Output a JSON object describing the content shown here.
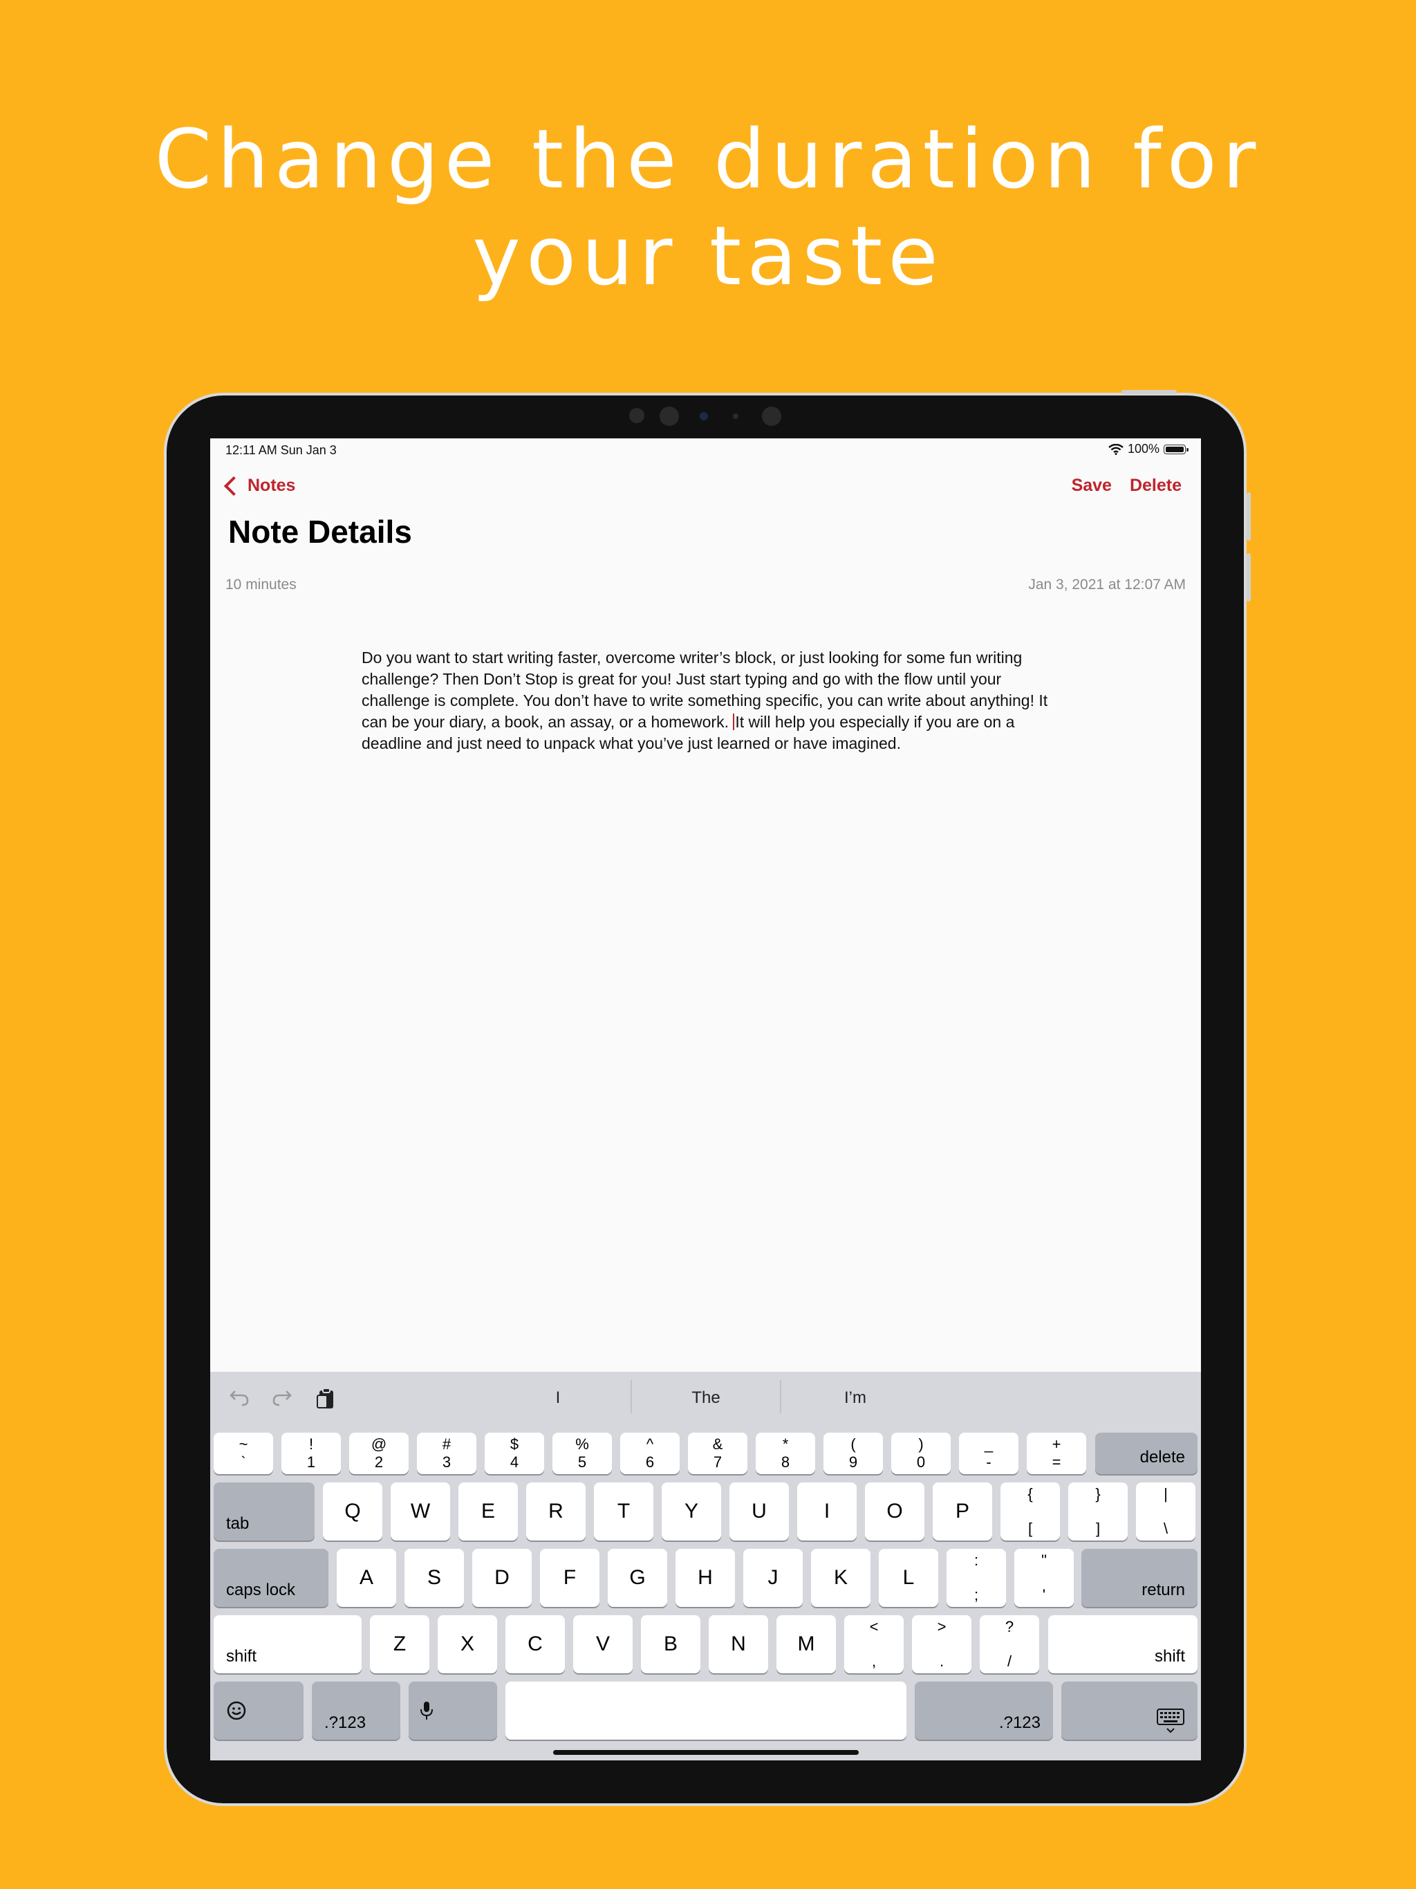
{
  "headline": {
    "line1": "Change the duration for",
    "line2": "your taste"
  },
  "status": {
    "time": "12:11 AM   Sun Jan 3",
    "battery": "100%",
    "wifi_icon": "wifi-icon",
    "battery_icon": "battery-icon"
  },
  "nav": {
    "back_label": "Notes",
    "save_label": "Save",
    "delete_label": "Delete"
  },
  "page": {
    "title": "Note Details",
    "duration": "10 minutes",
    "date": "Jan 3, 2021 at 12:07 AM"
  },
  "note": {
    "text_before_cursor": "Do you want to start writing faster, overcome writer’s block, or just looking for some fun writing challenge? Then Don’t Stop is great for you! Just start typing and go with the flow until your challenge is complete. You don’t have to write something specific, you can write about anything! It can be your diary, a book, an assay, or a homework. ",
    "text_after_cursor": "It will help you especially if you are on a deadline and just need to unpack what you’ve just learned or have imagined."
  },
  "keyboard": {
    "suggestions": [
      "I",
      "The",
      "I’m"
    ],
    "row1": [
      [
        "~",
        "`"
      ],
      [
        "!",
        "1"
      ],
      [
        "@",
        "2"
      ],
      [
        "#",
        "3"
      ],
      [
        "$",
        "4"
      ],
      [
        "%",
        "5"
      ],
      [
        "^",
        "6"
      ],
      [
        "&",
        "7"
      ],
      [
        "*",
        "8"
      ],
      [
        "(",
        "9"
      ],
      [
        ")",
        "0"
      ],
      [
        "_",
        "-"
      ],
      [
        "+",
        "="
      ]
    ],
    "delete": "delete",
    "tab": "tab",
    "row2": [
      "Q",
      "W",
      "E",
      "R",
      "T",
      "Y",
      "U",
      "I",
      "O",
      "P"
    ],
    "row2_sym": [
      [
        "{",
        "["
      ],
      [
        "}",
        "]"
      ],
      [
        "|",
        "\\"
      ]
    ],
    "caps": "caps lock",
    "row3": [
      "A",
      "S",
      "D",
      "F",
      "G",
      "H",
      "J",
      "K",
      "L"
    ],
    "row3_sym": [
      [
        ":",
        ";"
      ],
      [
        "\"",
        "'"
      ]
    ],
    "return": "return",
    "shift": "shift",
    "row4": [
      "Z",
      "X",
      "C",
      "V",
      "B",
      "N",
      "M"
    ],
    "row4_sym": [
      [
        "<",
        ","
      ],
      [
        ">",
        "."
      ],
      [
        "?",
        "/"
      ]
    ],
    "num_label": ".?123",
    "emoji_icon": "emoji-icon",
    "mic_icon": "microphone-icon",
    "dismiss_icon": "keyboard-dismiss-icon"
  },
  "colors": {
    "background": "#FDB21C",
    "accent": "#c0242c"
  }
}
